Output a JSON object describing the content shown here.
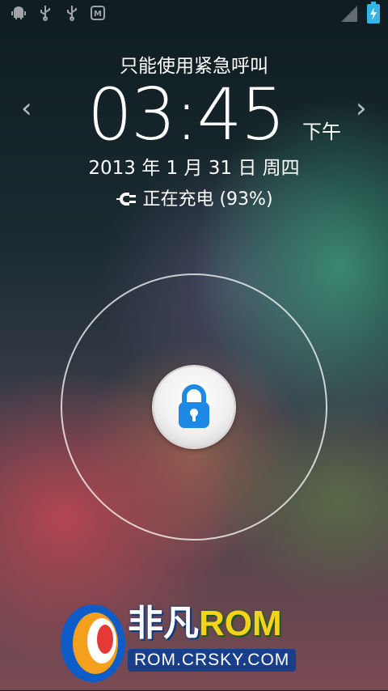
{
  "status_bar": {
    "left_icons": [
      "android-debug-icon",
      "usb-icon",
      "usb-icon",
      "app-notification-icon"
    ],
    "right_icons": [
      "signal-icon",
      "battery-charging-icon"
    ],
    "accent_color": "#33b5e5"
  },
  "lockscreen": {
    "emergency_text": "只能使用紧急呼叫",
    "time": "03:45",
    "ampm": "下午",
    "prev_arrow": "‹",
    "next_arrow": "›",
    "date": "2013 年 1 月 31 日 周四",
    "charging_text": "正在充电 (93%)",
    "battery_percent": 93,
    "unlock_icon": "lock-icon"
  },
  "watermark": {
    "brand_cn": "非凡",
    "brand_rom": "ROM",
    "url": "ROM.CRSKY.COM"
  }
}
